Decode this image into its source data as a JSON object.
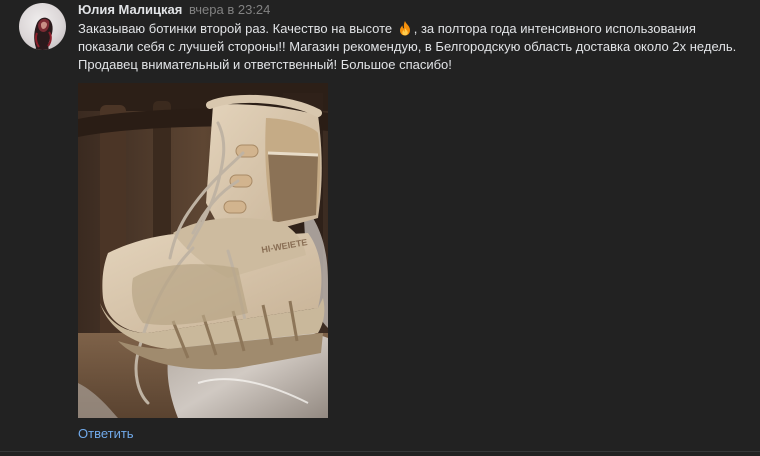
{
  "comment": {
    "author": "Юлия Малицкая",
    "time": "вчера в 23:24",
    "text_line1_a": "Заказываю ботинки второй раз. Качество на высоте",
    "emoji": "fire-emoji",
    "text_line1_b": ", за полтора года интенсивного использования",
    "text_line2": "показали себя с лучшей стороны!! Магазин рекомендую, в Белгородскую область доставка около 2х недель.",
    "text_line3": "Продавец внимательный и ответственный! Большое спасибо!",
    "photo_brand_text": "HI-WEIETE",
    "reply_label": "Ответить"
  },
  "colors": {
    "background": "#222222",
    "author": "#e1e3e6",
    "time": "#828282",
    "link": "#71aaeb"
  }
}
